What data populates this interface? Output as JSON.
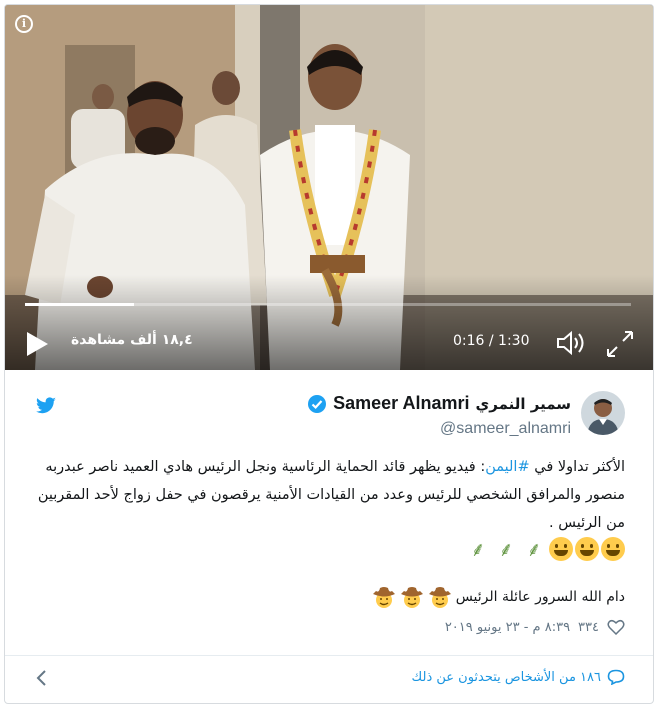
{
  "video": {
    "views": "١٨,٤ ألف مشاهدة",
    "time": "0:16 / 1:30",
    "progress": 0.18
  },
  "author": {
    "name_en": "Sameer Alnamri",
    "name_ar": "سمير النمري",
    "handle": "@sameer_alnamri",
    "verified": true
  },
  "tweet": {
    "text_before": "الأكثر تداولا في ",
    "hashtag": "#اليمن",
    "text_after": ": فيديو  يظهر قائد الحماية الرئاسية ونجل الرئيس هادي العميد ناصر عبدربه منصور والمرافق الشخصي للرئيس وعدد من القيادات الأمنية يرقصون في حفل زواج لأحد المقربين من الرئيس .",
    "emoji": [
      "grinning-face",
      "grinning-face",
      "grinning-face",
      "herb",
      "herb",
      "herb"
    ],
    "footer_line": "دام الله السرور عائلة الرئيس",
    "footer_emoji": [
      "cowboy-face",
      "cowboy-face",
      "cowboy-face"
    ]
  },
  "meta": {
    "likes": "٣٣٤",
    "timestamp": "٨:٣٩ م - ٢٣ يونيو ٢٠١٩"
  },
  "footer": {
    "replies_text": "١٨٦ من الأشخاص يتحدثون عن ذلك"
  },
  "colors": {
    "accent": "#1b95e0",
    "text": "#14171a",
    "muted": "#657786"
  }
}
